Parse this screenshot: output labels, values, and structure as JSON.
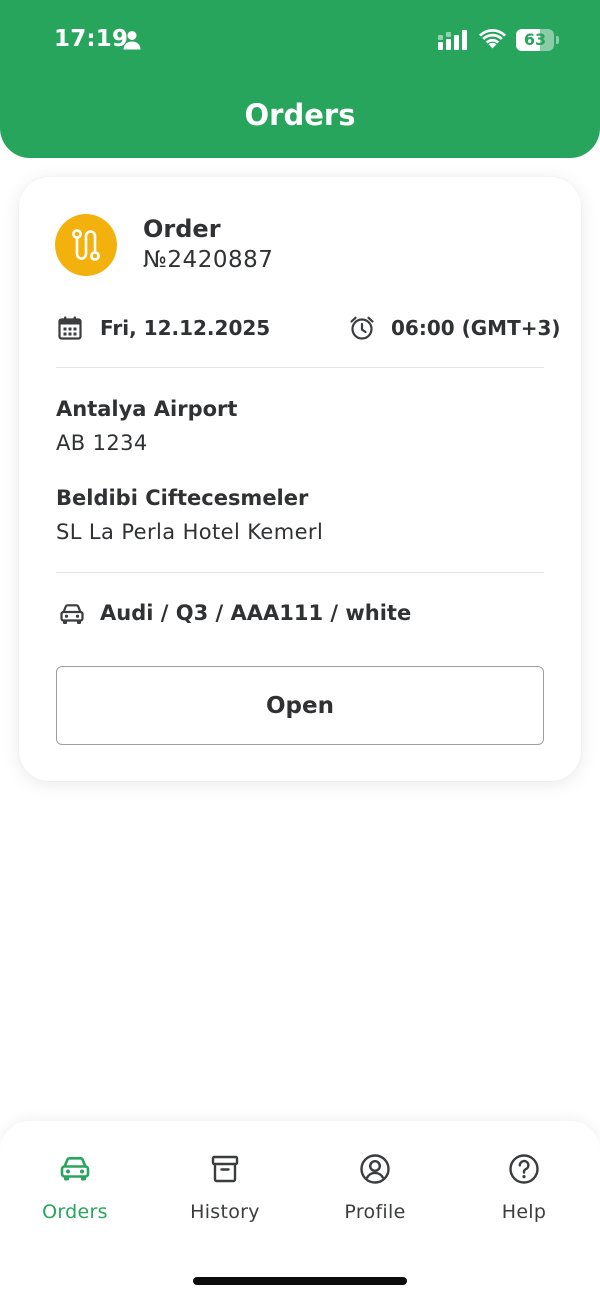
{
  "status_bar": {
    "time": "17:19",
    "battery_level": "63",
    "battery_fraction": 0.63
  },
  "header": {
    "title": "Orders",
    "color": "#28a55c"
  },
  "order_card": {
    "title": "Order",
    "number": "№2420887",
    "avatar_icon": "route-icon",
    "avatar_color": "#f3b10d",
    "date": "Fri, 12.12.2025",
    "time": "06:00 (GMT+3)",
    "from": {
      "place": "Antalya Airport",
      "detail": "AB 1234"
    },
    "to": {
      "place": "Beldibi Ciftecesmeler",
      "detail": "SL La Perla Hotel Kemerl"
    },
    "vehicle": "Audi / Q3 / AAA111 / white",
    "open_label": "Open"
  },
  "bottom_nav": {
    "items": [
      {
        "label": "Orders",
        "icon": "car-icon",
        "active": true
      },
      {
        "label": "History",
        "icon": "archive-icon",
        "active": false
      },
      {
        "label": "Profile",
        "icon": "user-circle-icon",
        "active": false
      },
      {
        "label": "Help",
        "icon": "help-circle-icon",
        "active": false
      }
    ]
  }
}
